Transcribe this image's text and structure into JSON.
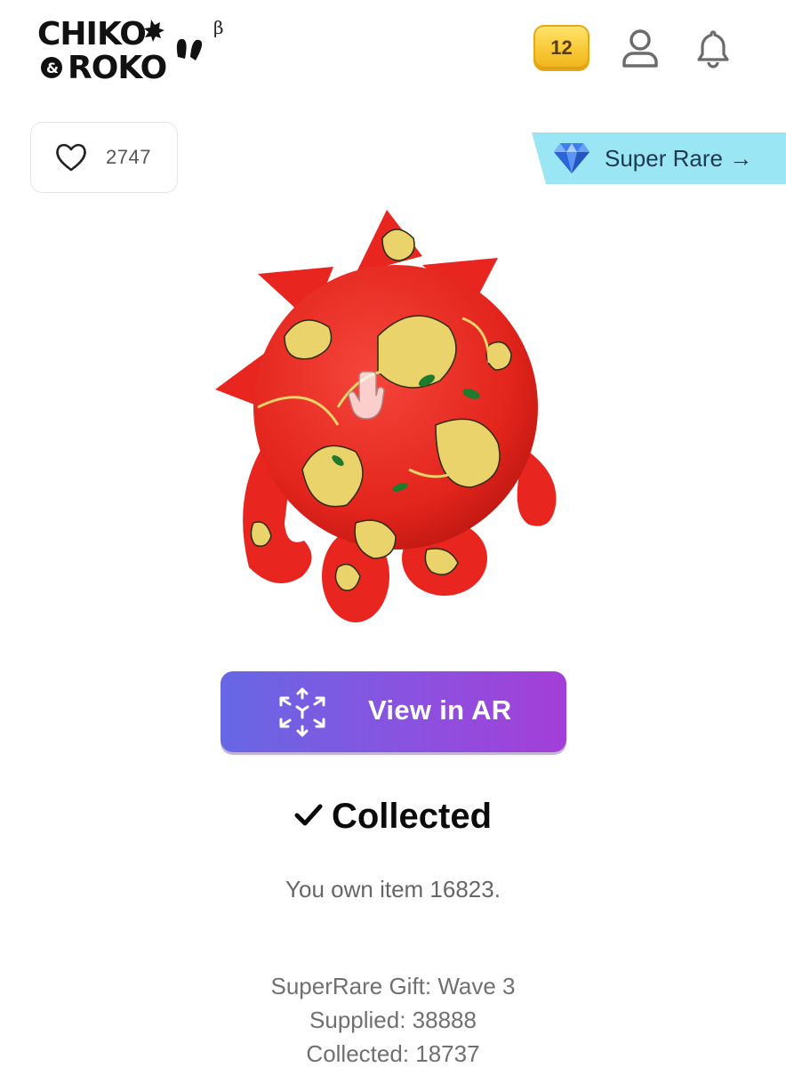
{
  "header": {
    "logo_line1": "CHIKO",
    "logo_amp": "&",
    "logo_line2": "ROKO",
    "logo_beta": "β",
    "coins": "12",
    "profile_icon": "user-icon",
    "notifications_icon": "bell-icon"
  },
  "item": {
    "likes": "2747",
    "rarity": "Super Rare",
    "rarity_arrow": "→",
    "ar_button_label": "View in AR",
    "status": "Collected",
    "owned_text": "You own item 16823.",
    "gift_wave": "SuperRare Gift: Wave 3",
    "supplied": "Supplied: 38888",
    "collected_count": "Collected: 18737"
  },
  "colors": {
    "coin_gold": "#f7c631",
    "rarity_banner": "#9be6f5",
    "ar_gradient_start": "#6767e4",
    "ar_gradient_end": "#a43ed8",
    "character_red": "#e8261f",
    "pattern_yellow": "#e9d36a"
  }
}
